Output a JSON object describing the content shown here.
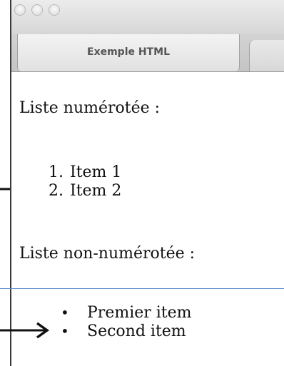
{
  "window": {
    "controls": [
      "close-button",
      "minimize-button",
      "zoom-button"
    ]
  },
  "tabs": [
    {
      "label": "Exemple HTML",
      "active": true
    },
    {
      "label": "",
      "active": false
    }
  ],
  "content": {
    "numbered_heading": "Liste numérotée :",
    "numbered_items": [
      {
        "marker": "1.",
        "text": "Item 1"
      },
      {
        "marker": "2.",
        "text": "Item 2"
      }
    ],
    "bullet_heading": "Liste non-numérotée :",
    "bullet_items": [
      {
        "marker": "•",
        "text": "Premier item"
      },
      {
        "marker": "•",
        "text": "Second item"
      }
    ]
  },
  "annotations": {
    "arrow_color": "#111111",
    "link_line_color": "#5b8bd0"
  }
}
